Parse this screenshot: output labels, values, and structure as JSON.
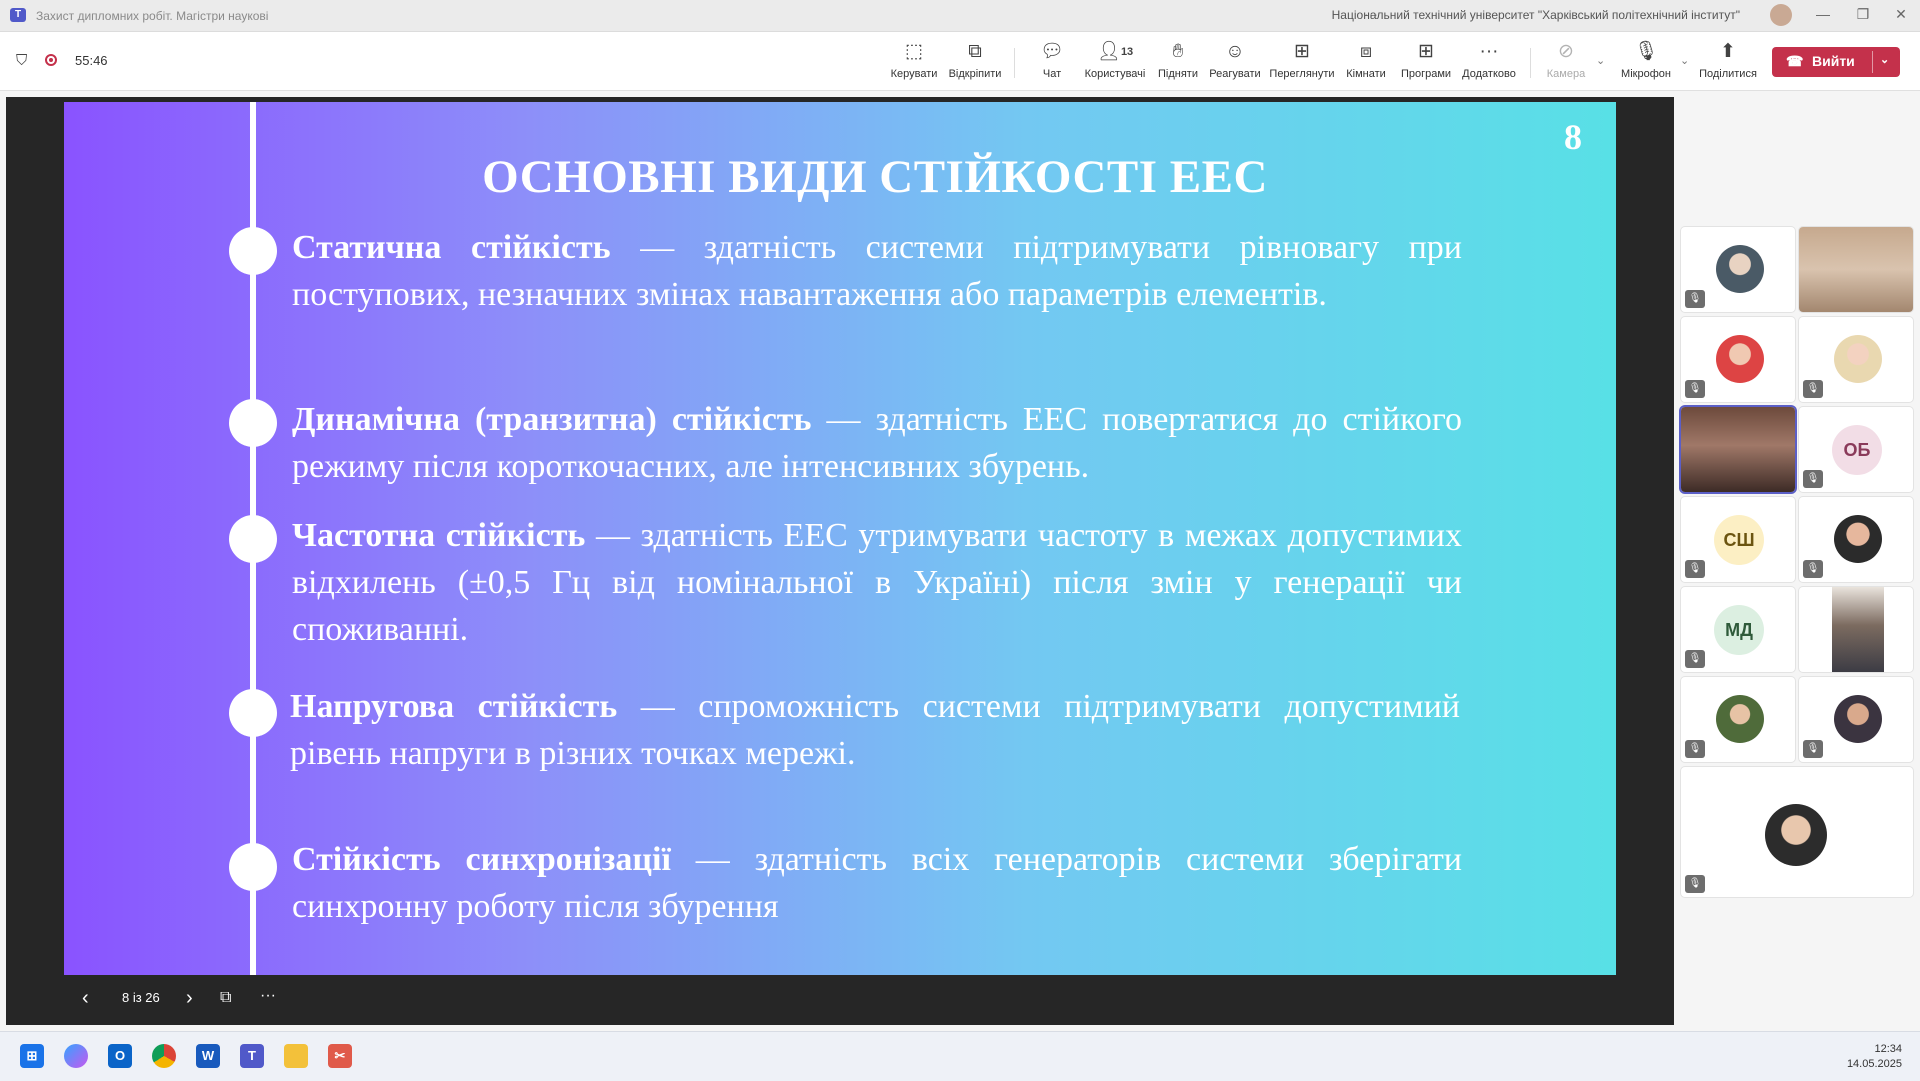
{
  "window": {
    "title": "Захист дипломних робіт. Магістри наукові",
    "organization": "Національний технічний університет \"Харківський політехнічний інститут\""
  },
  "meeting": {
    "timer": "55:46",
    "toolbar": {
      "manage": "Керувати",
      "popout": "Відкріпити",
      "chat": "Чат",
      "people": "Користувачі",
      "people_count": "13",
      "raise": "Підняти",
      "react": "Реагувати",
      "view": "Переглянути",
      "rooms": "Кімнати",
      "apps": "Програми",
      "more": "Додатково",
      "camera": "Камера",
      "mic": "Мікрофон",
      "share": "Поділитися",
      "leave": "Вийти"
    }
  },
  "slide": {
    "number": "8",
    "title": "ОСНОВНІ ВИДИ СТІЙКОСТІ ЕЕС",
    "items": [
      {
        "term": "Статична стійкість",
        "text": " — здатність системи підтримувати рівновагу при поступових, незначних змінах навантаження або параметрів елементів."
      },
      {
        "term": "Динамічна (транзитна) стійкість",
        "text": " — здатність ЕЕС повертатися до стійкого режиму після короткочасних, але інтенсивних збурень."
      },
      {
        "term": "Частотна стійкість",
        "text": " — здатність ЕЕС утримувати частоту в межах допустимих відхилень (±0,5 Гц від номінальної в Україні) після змін у генерації чи споживанні."
      },
      {
        "term": "Напругова стійкість",
        "text": " — спроможність системи підтримувати допустимий рівень напруги в різних точках мережі."
      },
      {
        "term": "Стійкість синхронізації",
        "text": " — здатність всіх генераторів системи зберігати синхронну роботу після збурення"
      }
    ],
    "pager": "8 із 26"
  },
  "participants": [
    {
      "initials": "ОБ"
    },
    {
      "initials": "СШ"
    },
    {
      "initials": "МД"
    }
  ],
  "taskbar": {
    "time": "12:34",
    "date": "14.05.2025"
  }
}
